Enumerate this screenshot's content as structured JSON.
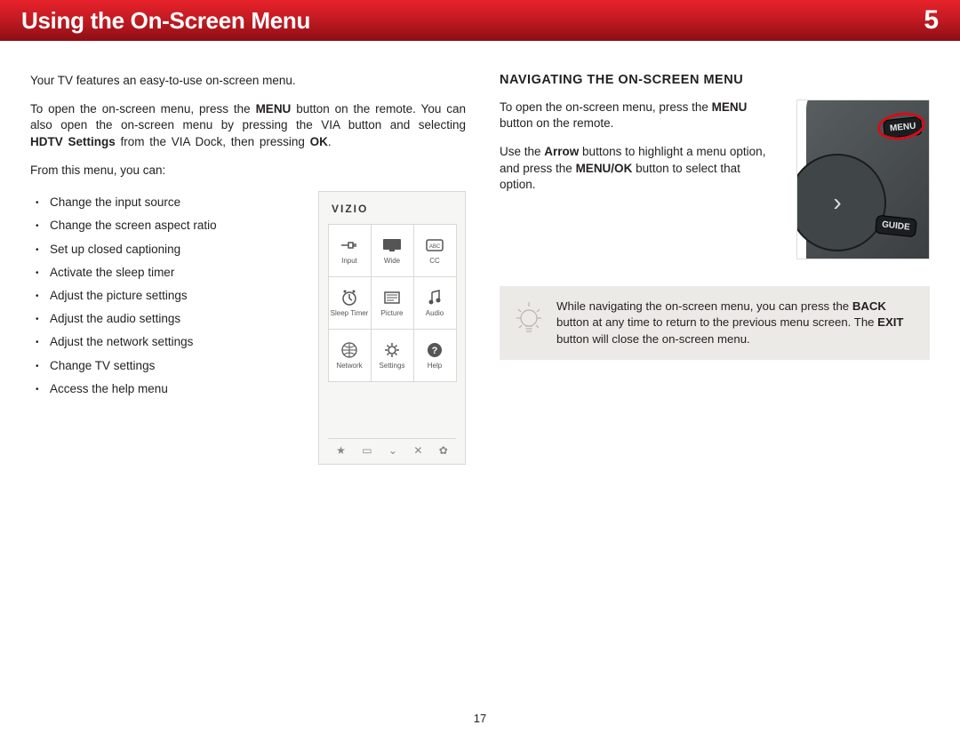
{
  "header": {
    "title": "Using the On-Screen Menu",
    "chapter_number": "5"
  },
  "page_number": "17",
  "left": {
    "intro": "Your TV features an easy-to-use on-screen menu.",
    "open_menu_1": "To open the on-screen menu, press the ",
    "open_menu_bold1": "MENU",
    "open_menu_2": " button on the remote. You can also open the on-screen menu by pressing the VIA button and selecting ",
    "open_menu_bold2": "HDTV Settings",
    "open_menu_3": " from the VIA Dock, then pressing ",
    "open_menu_bold3": "OK",
    "open_menu_4": ".",
    "from_menu": "From this menu, you can:",
    "bullets": [
      "Change the input source",
      "Change the screen aspect ratio",
      "Set up closed captioning",
      "Activate the sleep timer",
      "Adjust the picture settings",
      "Adjust the audio settings",
      "Adjust the network settings",
      "Change TV settings",
      "Access the help menu"
    ],
    "vizio": {
      "logo": "VIZIO",
      "cells": [
        "Input",
        "Wide",
        "CC",
        "Sleep Timer",
        "Picture",
        "Audio",
        "Network",
        "Settings",
        "Help"
      ]
    }
  },
  "right": {
    "section_title": "NAVIGATING THE ON-SCREEN MENU",
    "p1a": "To open the on-screen menu, press the ",
    "p1b": "MENU",
    "p1c": " button on the remote.",
    "p2a": "Use the ",
    "p2b": "Arrow",
    "p2c": " buttons to highlight a menu option, and press the ",
    "p2d": "MENU/OK",
    "p2e": " button to select that option.",
    "remote": {
      "menu": "MENU",
      "guide": "GUIDE"
    },
    "tip_1": "While navigating the on-screen menu, you can press the ",
    "tip_b1": "BACK",
    "tip_2": " button at any time to return to the previous menu screen. The ",
    "tip_b2": "EXIT",
    "tip_3": " button will close the on-screen menu."
  }
}
